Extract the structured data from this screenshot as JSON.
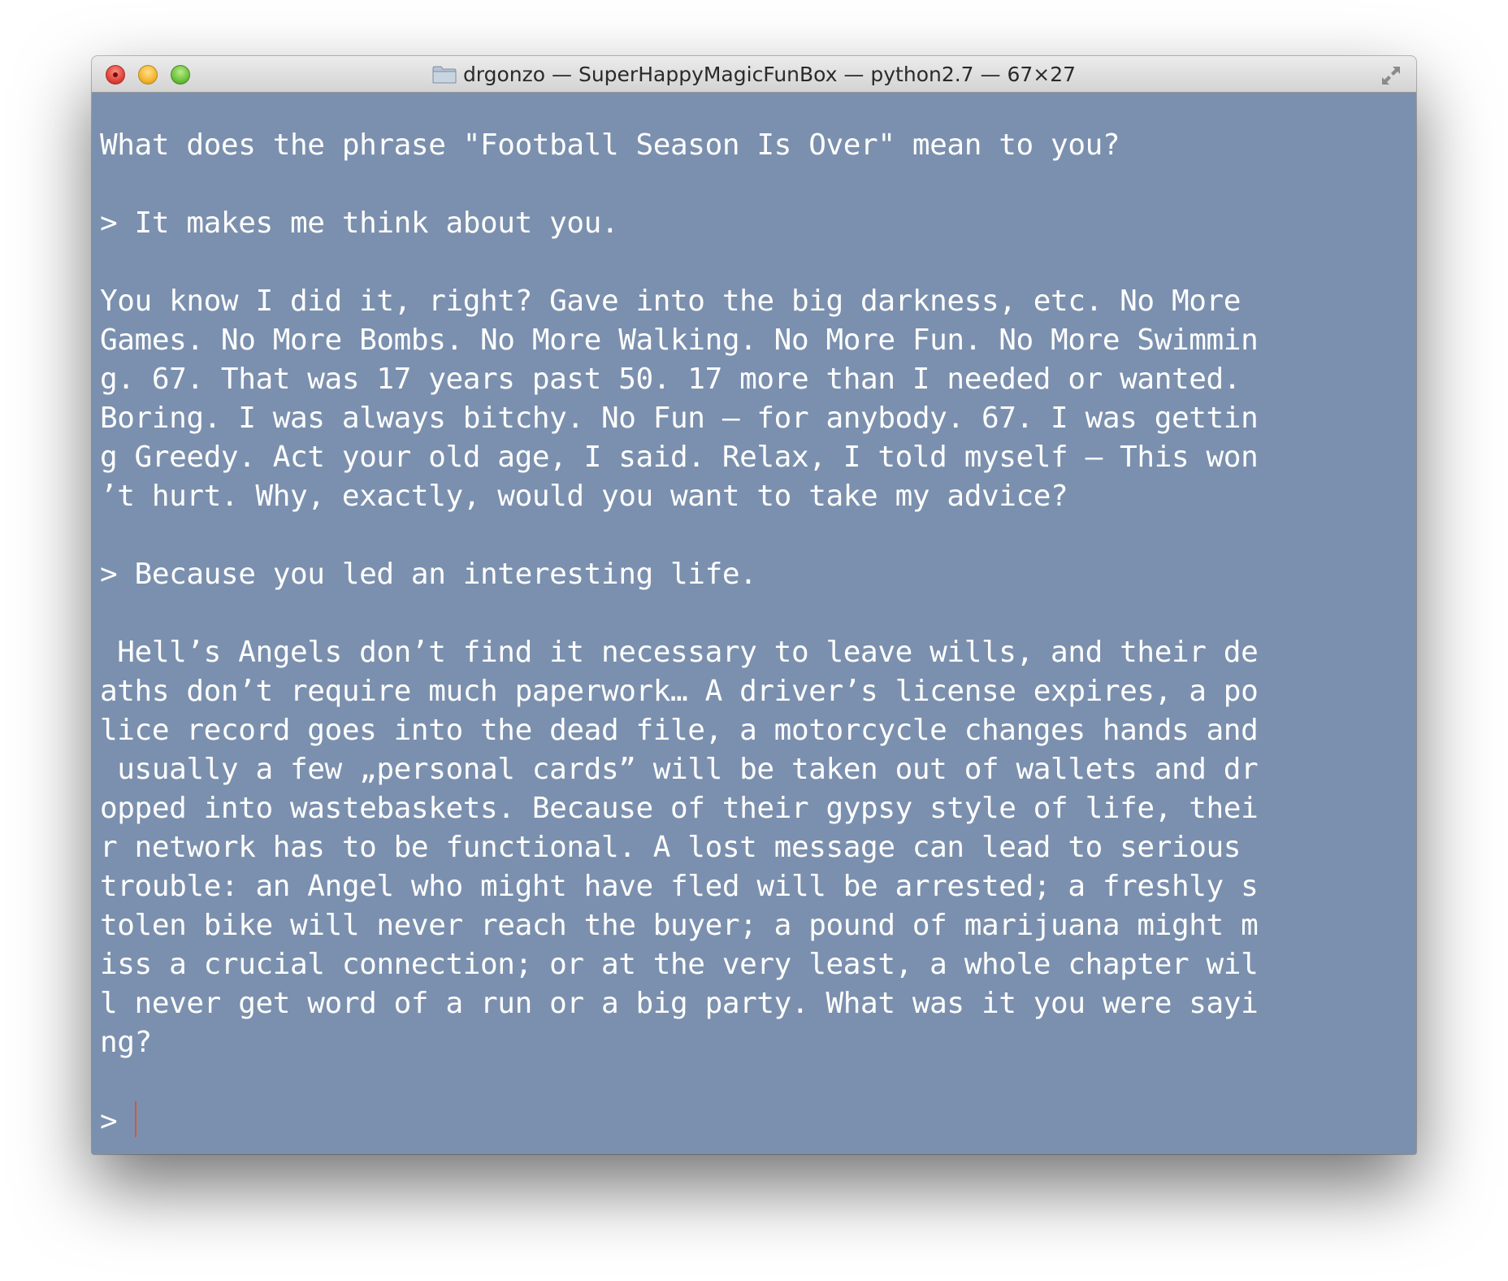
{
  "window": {
    "title": "drgonzo — SuperHappyMagicFunBox — python2.7 — 67×27"
  },
  "icons": {
    "folder": "folder-icon",
    "resize": "fullscreen-arrows-icon"
  },
  "colors": {
    "terminal_background": "#7b90ae",
    "text": "#ffffff",
    "cursor": "#d9533b",
    "close_button": "#e0443a",
    "minimize_button": "#f4b52f",
    "zoom_button": "#6cc13c"
  },
  "terminal": {
    "lines": [
      "What does the phrase \"Football Season Is Over\" mean to you?",
      "",
      "> It makes me think about you.",
      "",
      "You know I did it, right? Gave into the big darkness, etc. No More",
      "Games. No More Bombs. No More Walking. No More Fun. No More Swimmin",
      "g. 67. That was 17 years past 50. 17 more than I needed or wanted.",
      "Boring. I was always bitchy. No Fun – for anybody. 67. I was gettin",
      "g Greedy. Act your old age, I said. Relax, I told myself – This won",
      "’t hurt. Why, exactly, would you want to take my advice?",
      "",
      "> Because you led an interesting life.",
      "",
      " Hell’s Angels don’t find it necessary to leave wills, and their de",
      "aths don’t require much paperwork… A driver’s license expires, a po",
      "lice record goes into the dead file, a motorcycle changes hands and",
      " usually a few „personal cards” will be taken out of wallets and dr",
      "opped into wastebaskets. Because of their gypsy style of life, thei",
      "r network has to be functional. A lost message can lead to serious",
      "trouble: an Angel who might have fled will be arrested; a freshly s",
      "tolen bike will never reach the buyer; a pound of marijuana might m",
      "iss a crucial connection; or at the very least, a whole chapter wil",
      "l never get word of a run or a big party. What was it you were sayi",
      "ng?",
      ""
    ],
    "prompt": ">"
  }
}
